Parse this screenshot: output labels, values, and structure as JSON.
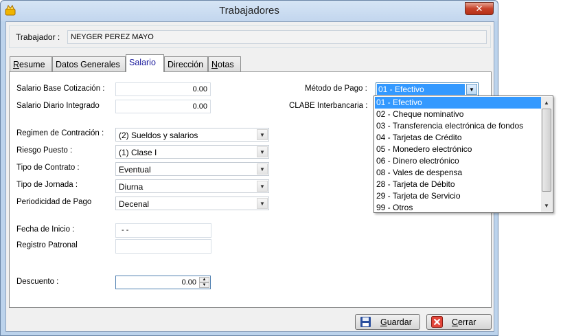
{
  "window": {
    "title": "Trabajadores",
    "close_glyph": "✕"
  },
  "worker": {
    "label": "Trabajador :",
    "value": "NEYGER PEREZ MAYO"
  },
  "tabs": [
    {
      "label": "Resume",
      "underline": "R",
      "rest": "esume"
    },
    {
      "label": "Datos Generales"
    },
    {
      "label": "Salario"
    },
    {
      "label": "Dirección"
    },
    {
      "label": "Notas",
      "underline": "N",
      "rest": "otas"
    }
  ],
  "salario": {
    "base_label": "Salario Base Cotización :",
    "base_value": "0.00",
    "diario_label": "Salario Diario Integrado",
    "diario_value": "0.00",
    "regimen_label": "Regimen de Contración :",
    "regimen_value": "(2) Sueldos y salarios",
    "riesgo_label": "Riesgo Puesto :",
    "riesgo_value": "(1) Clase I",
    "contrato_label": "Tipo de Contrato :",
    "contrato_value": "Eventual",
    "jornada_label": "Tipo de Jornada :",
    "jornada_value": "Diurna",
    "periodicidad_label": "Periodicidad de Pago",
    "periodicidad_value": "Decenal",
    "fecha_label": "Fecha de Inicio :",
    "fecha_value": "-  -",
    "registro_label": "Registro Patronal",
    "registro_value": "",
    "descuento_label": "Descuento :",
    "descuento_value": "0.00",
    "metodo_label": "Método de Pago :",
    "metodo_value": "01 - Efectivo",
    "clabe_label": "CLABE Interbancaria :"
  },
  "metodo_options": [
    "01 - Efectivo",
    "02 - Cheque nominativo",
    "03 - Transferencia electrónica de fondos",
    "04 - Tarjetas de Crédito",
    "05 - Monedero electrónico",
    "06 - Dinero electrónico",
    "08 - Vales de despensa",
    "28 - Tarjeta de Débito",
    "29 - Tarjeta de Servicio",
    "99 - Otros"
  ],
  "buttons": {
    "guardar_u": "G",
    "guardar_rest": "uardar",
    "cerrar_u": "C",
    "cerrar_rest": "errar"
  },
  "icons": {
    "app": "app-icon",
    "save": "floppy-disk-icon",
    "close": "close-icon"
  },
  "colors": {
    "selection": "#3399ff",
    "tab_active_text": "#1a1a9c"
  }
}
